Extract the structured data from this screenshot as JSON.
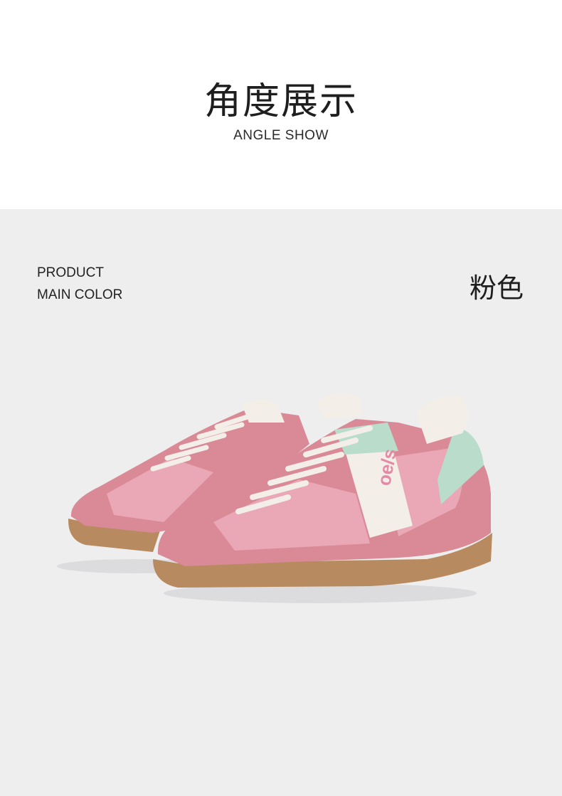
{
  "header": {
    "title_cn": "角度展示",
    "title_en": "ANGLE SHOW"
  },
  "panel": {
    "label_line1": "PRODUCT",
    "label_line2": "MAIN COLOR",
    "color_name": "粉色"
  },
  "product_image": {
    "icon": "pink-sneakers-image",
    "colors": {
      "suede": "#d98a96",
      "mesh": "#eaa7b6",
      "sole": "#b88a60",
      "mint": "#b9dccb",
      "cream": "#f3efe8",
      "panel_bg": "#eeeeef"
    }
  }
}
